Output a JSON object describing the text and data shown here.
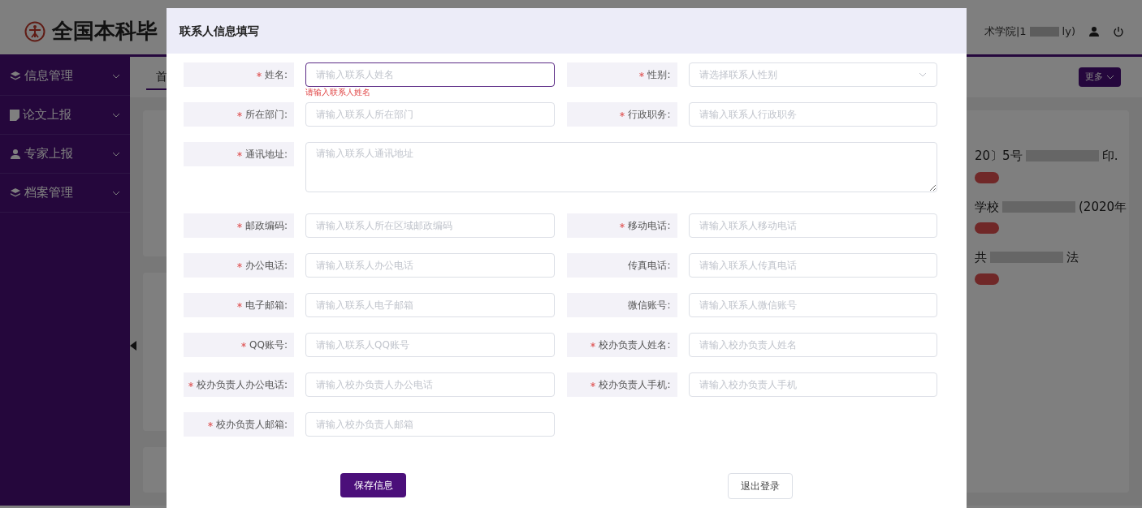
{
  "header": {
    "site_title": "全国本科毕",
    "user_text_start": "术学院|1",
    "user_text_end": "ly)"
  },
  "sidebar": {
    "items": [
      {
        "label": "信息管理",
        "expanded": false
      },
      {
        "label": "论文上报",
        "expanded": false
      },
      {
        "label": "专家上报",
        "expanded": false
      },
      {
        "label": "档案管理",
        "expanded": false
      }
    ]
  },
  "tabs": [
    {
      "label": "首",
      "selected": true
    }
  ],
  "more_button": "更多",
  "notices": [
    {
      "start": "20〕5号",
      "end": "印."
    },
    {
      "start": "学校",
      "end": "(2020年"
    },
    {
      "start": "共",
      "end": "法"
    }
  ],
  "dialog": {
    "title": "联系人信息填写",
    "fields": [
      {
        "label": "姓名:",
        "required": true,
        "kind": "input",
        "placeholder": "请输入联系人姓名",
        "focused": true,
        "error": "请输入联系人姓名"
      },
      {
        "label": "性别:",
        "required": true,
        "kind": "select",
        "placeholder": "请选择联系人性别",
        "focused": false
      },
      {
        "label": "所在部门:",
        "required": true,
        "kind": "input",
        "placeholder": "请输入联系人所在部门",
        "focused": false
      },
      {
        "label": "行政职务:",
        "required": true,
        "kind": "input",
        "placeholder": "请输入联系人行政职务",
        "focused": false
      },
      {
        "label": "通讯地址:",
        "required": true,
        "kind": "textarea",
        "placeholder": "请输入联系人通讯地址",
        "focused": false
      },
      {
        "label": "邮政编码:",
        "required": true,
        "kind": "input",
        "placeholder": "请输入联系人所在区域邮政编码",
        "focused": false
      },
      {
        "label": "移动电话:",
        "required": true,
        "kind": "input",
        "placeholder": "请输入联系人移动电话",
        "focused": false
      },
      {
        "label": "办公电话:",
        "required": true,
        "kind": "input",
        "placeholder": "请输入联系人办公电话",
        "focused": false
      },
      {
        "label": "传真电话:",
        "required": false,
        "kind": "input",
        "placeholder": "请输入联系人传真电话",
        "focused": false
      },
      {
        "label": "电子邮箱:",
        "required": true,
        "kind": "input",
        "placeholder": "请输入联系人电子邮箱",
        "focused": false
      },
      {
        "label": "微信账号:",
        "required": false,
        "kind": "input",
        "placeholder": "请输入联系人微信账号",
        "focused": false
      },
      {
        "label": "QQ账号:",
        "required": true,
        "kind": "input",
        "placeholder": "请输入联系人QQ账号",
        "focused": false
      },
      {
        "label": "校办负责人姓名:",
        "required": true,
        "kind": "input",
        "placeholder": "请输入校办负责人姓名",
        "focused": false
      },
      {
        "label": "校办负责人办公电话:",
        "required": true,
        "kind": "input",
        "placeholder": "请输入校办负责人办公电话",
        "focused": false
      },
      {
        "label": "校办负责人手机:",
        "required": true,
        "kind": "input",
        "placeholder": "请输入校办负责人手机",
        "focused": false
      },
      {
        "label": "校办负责人邮箱:",
        "required": true,
        "kind": "input",
        "placeholder": "请输入校办负责人邮箱",
        "focused": false
      }
    ],
    "buttons": [
      {
        "label": "保存信息",
        "kind": "primary"
      },
      {
        "label": "退出登录",
        "kind": "secondary"
      }
    ]
  }
}
